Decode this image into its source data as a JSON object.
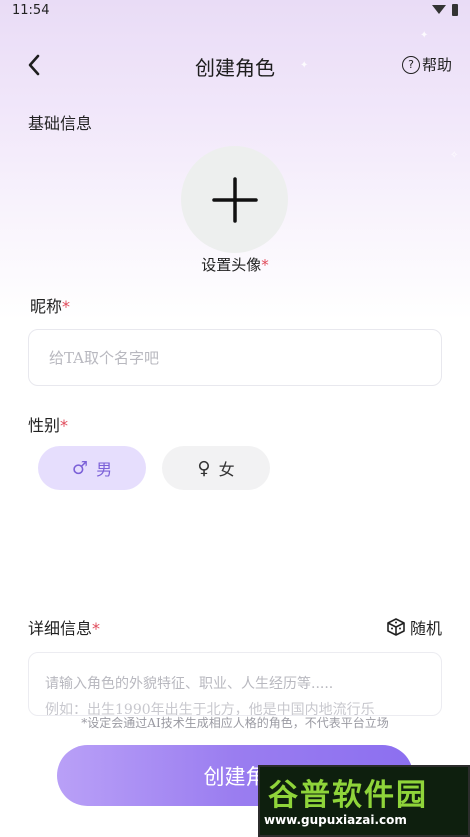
{
  "status_bar": {
    "time": "11:54"
  },
  "header": {
    "title": "创建角色",
    "help_icon": "?",
    "help_label": "帮助"
  },
  "basic_info": {
    "section_title": "基础信息",
    "avatar_label": "设置头像",
    "required_mark": "*"
  },
  "nickname": {
    "label": "昵称",
    "required_mark": "*",
    "placeholder": "给TA取个名字吧"
  },
  "gender": {
    "label": "性别",
    "required_mark": "*",
    "options": [
      {
        "icon": "♂",
        "label": "男",
        "selected": true
      },
      {
        "icon": "♀",
        "label": "女",
        "selected": false
      }
    ]
  },
  "detail": {
    "label": "详细信息",
    "required_mark": "*",
    "random_label": "随机",
    "placeholder": "请输入角色的外貌特征、职业、人生经历等.....",
    "example_text": "例如：出生1990年出生于北方，他是中国内地流行乐"
  },
  "disclaimer": "*设定会通过AI技术生成相应人格的角色，不代表平台立场",
  "create_button_label": "创建角",
  "watermark": {
    "top": "谷普软件园",
    "bottom": "www.gupuxiazai.com"
  },
  "colors": {
    "accent": "#8c6ff0",
    "required": "#e04a5a",
    "male_bg": "#e6defd",
    "male_text": "#7b60d8",
    "female_bg": "#f2f2f3"
  }
}
